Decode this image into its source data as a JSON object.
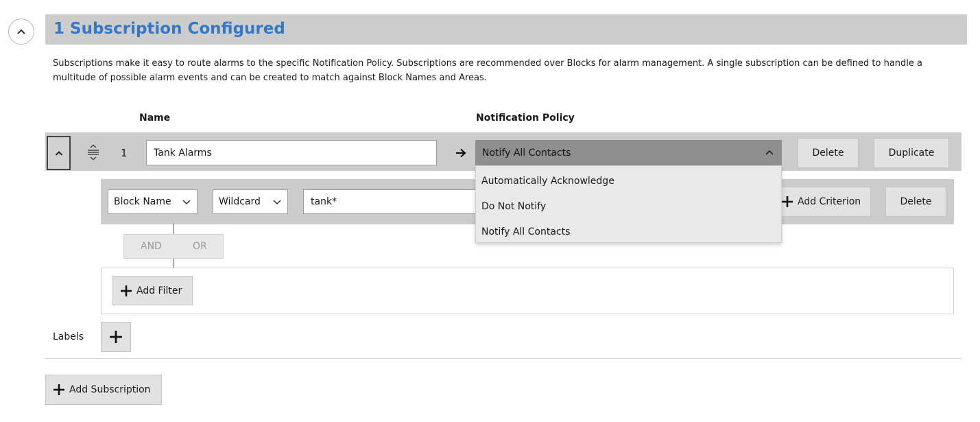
{
  "section": {
    "title": "1 Subscription Configured",
    "description": "Subscriptions make it easy to route alarms to the specific Notification Policy. Subscriptions are recommended over Blocks for alarm management. A single subscription can be defined to handle a multitude of possible alarm events and can be created to match against Block Names and Areas."
  },
  "columns": {
    "name": "Name",
    "notification_policy": "Notification Policy"
  },
  "subscription": {
    "index": "1",
    "name_value": "Tank Alarms",
    "policy_selected": "Notify All Contacts",
    "delete_label": "Delete",
    "duplicate_label": "Duplicate"
  },
  "policy_options": [
    "Automatically Acknowledge",
    "Do Not Notify",
    "Notify All Contacts"
  ],
  "criterion": {
    "field": "Block Name",
    "operator": "Wildcard",
    "value": "tank*",
    "add_criterion_label": "Add Criterion",
    "delete_label": "Delete"
  },
  "logic": {
    "and_label": "AND",
    "or_label": "OR"
  },
  "filter": {
    "add_filter_label": "Add Filter"
  },
  "labels": {
    "label": "Labels"
  },
  "footer": {
    "add_subscription_label": "Add Subscription"
  },
  "colors": {
    "title_blue": "#3478c6",
    "header_gray": "#cdcdcd",
    "row_gray": "#cccccc",
    "dropdown_selected_bg": "#8f8f8f",
    "menu_bg": "#e9e9e9"
  },
  "icons": {
    "section_collapse": "chevron-up-icon",
    "row_collapse": "chevron-up-icon",
    "drag": "drag-handle-icon",
    "arrow": "arrow-right-icon",
    "dropdown_open": "chevron-up-icon",
    "select": "chevron-down-icon",
    "add": "plus-icon"
  }
}
